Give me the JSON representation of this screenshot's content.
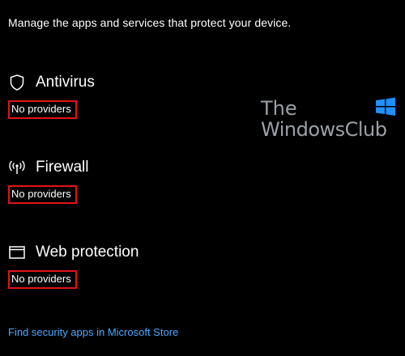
{
  "header": {
    "subtitle": "Manage the apps and services that protect your device."
  },
  "sections": [
    {
      "title": "Antivirus",
      "status": "No providers",
      "icon": "shield-icon"
    },
    {
      "title": "Firewall",
      "status": "No providers",
      "icon": "antenna-icon"
    },
    {
      "title": "Web protection",
      "status": "No providers",
      "icon": "window-icon"
    }
  ],
  "footer": {
    "link": "Find security apps in Microsoft Store"
  },
  "watermark": {
    "line1": "The",
    "line2": "WindowsClub"
  },
  "colors": {
    "background": "#000000",
    "text": "#ffffff",
    "highlight": "#e11414",
    "link": "#4aa8ff"
  }
}
